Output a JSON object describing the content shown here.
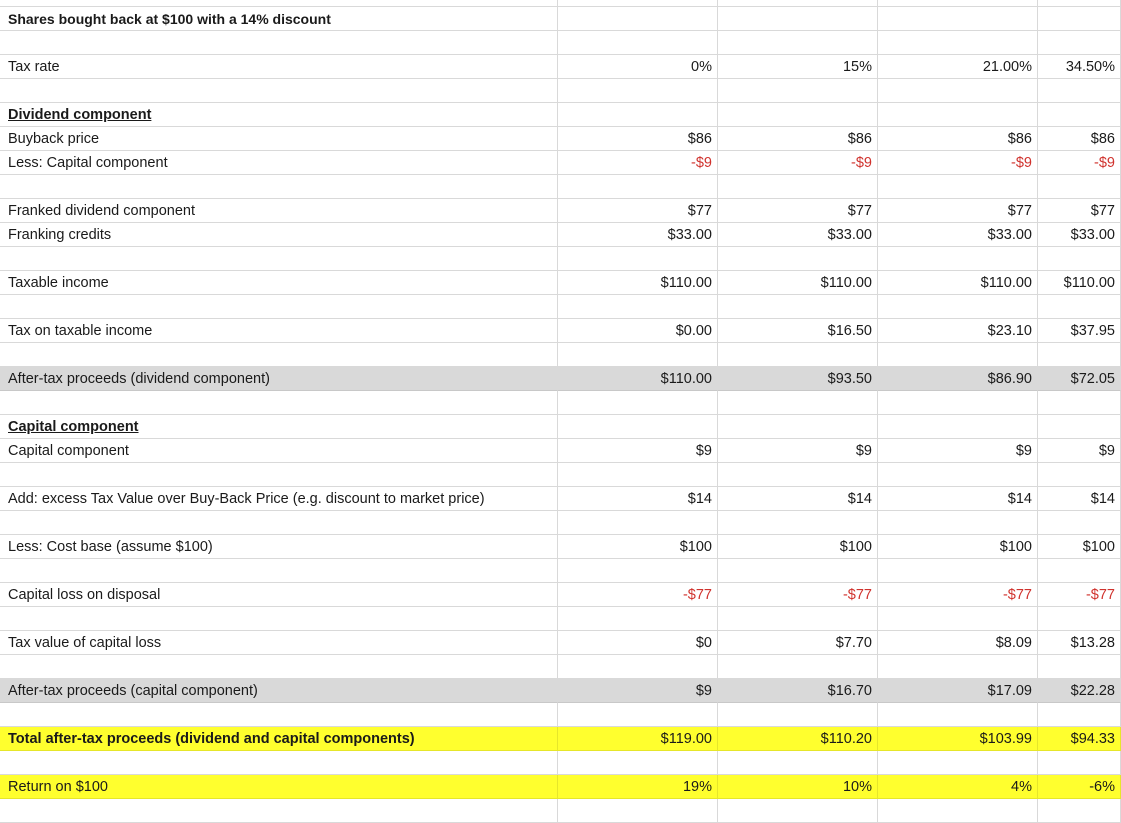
{
  "sheet": {
    "rows": [
      {
        "label": "Shares bought back at $100 with a 14% discount",
        "style": "title",
        "values": [
          "",
          "",
          "",
          ""
        ]
      },
      {
        "label": "",
        "values": [
          "",
          "",
          "",
          ""
        ]
      },
      {
        "label": "Tax rate",
        "values": [
          "0%",
          "15%",
          "21.00%",
          "34.50%"
        ]
      },
      {
        "label": "",
        "values": [
          "",
          "",
          "",
          ""
        ]
      },
      {
        "label": "Dividend component",
        "style": "section",
        "values": [
          "",
          "",
          "",
          ""
        ]
      },
      {
        "label": "Buyback price",
        "values": [
          "$86",
          "$86",
          "$86",
          "$86"
        ]
      },
      {
        "label": "Less: Capital component",
        "values": [
          "-$9",
          "-$9",
          "-$9",
          "-$9"
        ],
        "negative": true
      },
      {
        "label": "",
        "values": [
          "",
          "",
          "",
          ""
        ]
      },
      {
        "label": "Franked dividend component",
        "values": [
          "$77",
          "$77",
          "$77",
          "$77"
        ]
      },
      {
        "label": "Franking credits",
        "values": [
          "$33.00",
          "$33.00",
          "$33.00",
          "$33.00"
        ]
      },
      {
        "label": "",
        "values": [
          "",
          "",
          "",
          ""
        ]
      },
      {
        "label": "Taxable income",
        "values": [
          "$110.00",
          "$110.00",
          "$110.00",
          "$110.00"
        ]
      },
      {
        "label": "",
        "values": [
          "",
          "",
          "",
          ""
        ]
      },
      {
        "label": "Tax on taxable income",
        "values": [
          "$0.00",
          "$16.50",
          "$23.10",
          "$37.95"
        ]
      },
      {
        "label": "",
        "values": [
          "",
          "",
          "",
          ""
        ]
      },
      {
        "label": "After-tax proceeds (dividend component)",
        "style": "shade",
        "values": [
          "$110.00",
          "$93.50",
          "$86.90",
          "$72.05"
        ]
      },
      {
        "label": "",
        "values": [
          "",
          "",
          "",
          ""
        ]
      },
      {
        "label": "Capital component",
        "style": "section",
        "values": [
          "",
          "",
          "",
          ""
        ]
      },
      {
        "label": "Capital component",
        "values": [
          "$9",
          "$9",
          "$9",
          "$9"
        ]
      },
      {
        "label": "",
        "values": [
          "",
          "",
          "",
          ""
        ]
      },
      {
        "label": "Add: excess Tax Value over Buy-Back Price (e.g. discount to market price)",
        "values": [
          "$14",
          "$14",
          "$14",
          "$14"
        ]
      },
      {
        "label": "",
        "values": [
          "",
          "",
          "",
          ""
        ]
      },
      {
        "label": "Less: Cost base (assume $100)",
        "values": [
          "$100",
          "$100",
          "$100",
          "$100"
        ]
      },
      {
        "label": "",
        "values": [
          "",
          "",
          "",
          ""
        ]
      },
      {
        "label": "Capital loss on disposal",
        "values": [
          "-$77",
          "-$77",
          "-$77",
          "-$77"
        ],
        "negative": true
      },
      {
        "label": "",
        "values": [
          "",
          "",
          "",
          ""
        ]
      },
      {
        "label": "Tax value of capital loss",
        "values": [
          "$0",
          "$7.70",
          "$8.09",
          "$13.28"
        ]
      },
      {
        "label": "",
        "values": [
          "",
          "",
          "",
          ""
        ]
      },
      {
        "label": "After-tax proceeds (capital component)",
        "style": "shade",
        "values": [
          "$9",
          "$16.70",
          "$17.09",
          "$22.28"
        ]
      },
      {
        "label": "",
        "values": [
          "",
          "",
          "",
          ""
        ]
      },
      {
        "label": "Total after-tax proceeds (dividend and capital components)",
        "style": "yellow-bold",
        "values": [
          "$119.00",
          "$110.20",
          "$103.99",
          "$94.33"
        ]
      },
      {
        "label": "",
        "values": [
          "",
          "",
          "",
          ""
        ]
      },
      {
        "label": "Return on $100",
        "style": "yellow",
        "values": [
          "19%",
          "10%",
          "4%",
          "-6%"
        ]
      }
    ],
    "colors": {
      "shade": "#d9d9d9",
      "highlight": "#ffff2e",
      "negative": "#d0322d",
      "gridline": "#d9d9d9"
    }
  }
}
